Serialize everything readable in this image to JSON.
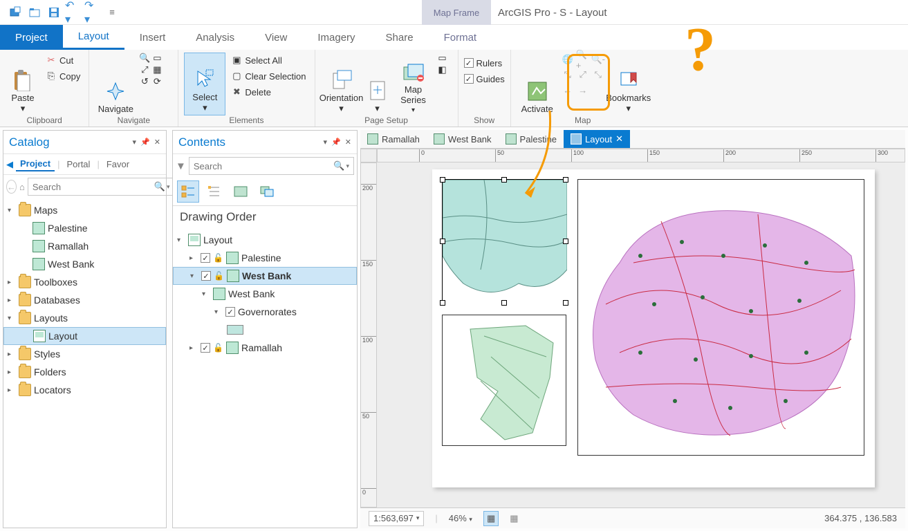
{
  "titlebar": {
    "context_tab": "Map Frame",
    "app_title": "ArcGIS Pro - S - Layout"
  },
  "ribbon_tabs": {
    "project": "Project",
    "layout": "Layout",
    "insert": "Insert",
    "analysis": "Analysis",
    "view": "View",
    "imagery": "Imagery",
    "share": "Share",
    "format": "Format"
  },
  "ribbon": {
    "clipboard": {
      "paste": "Paste",
      "cut": "Cut",
      "copy": "Copy",
      "group": "Clipboard"
    },
    "navigate": {
      "navigate": "Navigate",
      "group": "Navigate"
    },
    "elements": {
      "select": "Select",
      "select_all": "Select All",
      "clear": "Clear Selection",
      "delete": "Delete",
      "group": "Elements"
    },
    "page_setup": {
      "orientation": "Orientation",
      "map_series": "Map\nSeries",
      "group": "Page Setup"
    },
    "show": {
      "rulers": "Rulers",
      "guides": "Guides",
      "group": "Show"
    },
    "mapgrp": {
      "activate": "Activate",
      "bookmarks": "Bookmarks",
      "group": "Map"
    }
  },
  "catalog": {
    "title": "Catalog",
    "tabs": {
      "project": "Project",
      "portal": "Portal",
      "favorites": "Favor"
    },
    "search_placeholder": "Search",
    "tree": {
      "maps": "Maps",
      "palestine": "Palestine",
      "ramallah": "Ramallah",
      "west_bank": "West Bank",
      "toolboxes": "Toolboxes",
      "databases": "Databases",
      "layouts": "Layouts",
      "layout": "Layout",
      "styles": "Styles",
      "folders": "Folders",
      "locators": "Locators"
    }
  },
  "contents": {
    "title": "Contents",
    "search_placeholder": "Search",
    "section": "Drawing Order",
    "tree": {
      "layout": "Layout",
      "palestine": "Palestine",
      "west_bank_frame": "West Bank",
      "west_bank_map": "West Bank",
      "governorates": "Governorates",
      "ramallah": "Ramallah"
    }
  },
  "viewtabs": {
    "ramallah": "Ramallah",
    "west_bank": "West Bank",
    "palestine": "Palestine",
    "layout": "Layout"
  },
  "ruler": {
    "t0": "0",
    "t50": "50",
    "t100": "100",
    "t150": "150",
    "t200": "200",
    "t250": "250",
    "t300": "300"
  },
  "status": {
    "scale": "1:563,697",
    "zoom": "46%",
    "coords": "364.375 , 136.583"
  }
}
